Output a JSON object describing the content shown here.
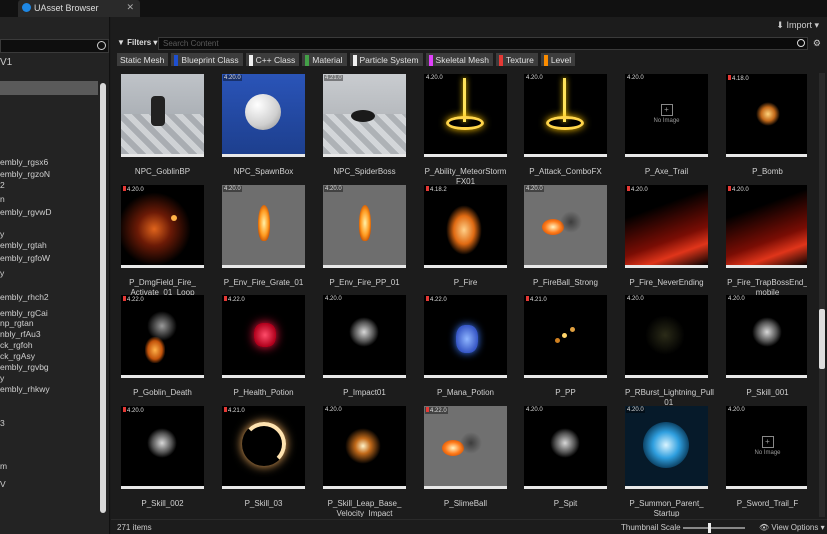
{
  "window": {
    "title": "UAsset Browser"
  },
  "sidebar": {
    "header": "V1",
    "items": [
      "embly_rgsx6",
      "embly_rgzoN",
      "2",
      "n",
      "embly_rgvwD",
      "y",
      "embly_rgtah",
      "embly_rgfoW",
      "y",
      "embly_rhch2",
      "embly_rgCai",
      "np_rgtan",
      "nbly_rfAu3",
      "ck_rgfoh",
      "ck_rgAsy",
      "embly_rgvbg",
      "y",
      "embly_rhkwy",
      "3",
      "m",
      "V"
    ]
  },
  "toolbar": {
    "import_label": "Import"
  },
  "filters": {
    "button_label": "Filters",
    "search_placeholder": "Search Content",
    "chips": [
      {
        "label": "Static Mesh",
        "color": "#1e88e5",
        "active": false
      },
      {
        "label": "Blueprint Class",
        "color": "#1e4fd0"
      },
      {
        "label": "C++ Class",
        "color": "#f0f0f0"
      },
      {
        "label": "Material",
        "color": "#43a047"
      },
      {
        "label": "Particle System",
        "color": "#f0f0f0"
      },
      {
        "label": "Skeletal Mesh",
        "color": "#e040fb"
      },
      {
        "label": "Texture",
        "color": "#e53935"
      },
      {
        "label": "Level",
        "color": "#fb8c00"
      }
    ]
  },
  "assets": [
    {
      "name": "NPC_GoblinBP",
      "ver": "",
      "kind": "goblin"
    },
    {
      "name": "NPC_SpawnBox",
      "ver": "4.20.0",
      "kind": "sphere"
    },
    {
      "name": "NPC_SpiderBoss",
      "ver": "4.21.0",
      "kind": "spider"
    },
    {
      "name": "P_Ability_MeteorStorm\nFX01",
      "ver": "4.20.0",
      "kind": "lightning"
    },
    {
      "name": "P_Attack_ComboFX",
      "ver": "4.20.0",
      "kind": "lightning"
    },
    {
      "name": "P_Axe_Trail",
      "ver": "4.20.0",
      "kind": "noimage",
      "noimage": "No Image"
    },
    {
      "name": "P_Bomb",
      "ver": "4.18.0",
      "kind": "spark",
      "red": true
    },
    {
      "name": "P_DmgField_Fire_\nActivate_01_Loop",
      "ver": "4.20.0",
      "kind": "embers",
      "red": true
    },
    {
      "name": "P_Env_Fire_Grate_01",
      "ver": "4.20.0",
      "kind": "flame"
    },
    {
      "name": "P_Env_Fire_PP_01",
      "ver": "4.20.0",
      "kind": "flame"
    },
    {
      "name": "P_Fire",
      "ver": "4.18.2",
      "kind": "fire",
      "red": true
    },
    {
      "name": "P_FireBall_Strong",
      "ver": "4.20.0",
      "kind": "fireball"
    },
    {
      "name": "P_Fire_NeverEnding",
      "ver": "4.20.0",
      "kind": "firewall",
      "red": true
    },
    {
      "name": "P_Fire_TrapBossEnd_\nmobile",
      "ver": "4.20.0",
      "kind": "firewall",
      "red": true
    },
    {
      "name": "P_Goblin_Death",
      "ver": "4.22.0",
      "kind": "smokefire",
      "red": true
    },
    {
      "name": "P_Health_Potion",
      "ver": "4.22.0",
      "kind": "potionred",
      "red": true
    },
    {
      "name": "P_Impact01",
      "ver": "4.20.0",
      "kind": "smoke"
    },
    {
      "name": "P_Mana_Potion",
      "ver": "4.22.0",
      "kind": "potionblue",
      "red": true
    },
    {
      "name": "P_PP",
      "ver": "4.21.0",
      "kind": "sparks",
      "red": true
    },
    {
      "name": "P_RBurst_Lightning_Pull\n_01",
      "ver": "4.20.0",
      "kind": "dark"
    },
    {
      "name": "P_Skill_001",
      "ver": "4.20.0",
      "kind": "smoke"
    },
    {
      "name": "P_Skill_002",
      "ver": "4.20.0",
      "kind": "smoke",
      "red": true
    },
    {
      "name": "P_Skill_03",
      "ver": "4.21.0",
      "kind": "ring",
      "red": true
    },
    {
      "name": "P_Skill_Leap_Base_\nVelocity_Impact",
      "ver": "4.20.0",
      "kind": "burst"
    },
    {
      "name": "P_SlimeBall",
      "ver": "4.22.0",
      "kind": "fireball",
      "red": true
    },
    {
      "name": "P_Spit",
      "ver": "4.20.0",
      "kind": "smoke"
    },
    {
      "name": "P_Summon_Parent_\nStartup",
      "ver": "4.20.0",
      "kind": "blueorb"
    },
    {
      "name": "P_Sword_Trail_F",
      "ver": "4.20.0",
      "kind": "noimage",
      "noimage": "No Image"
    }
  ],
  "status": {
    "items_count": "271 items",
    "thumbnail_scale_label": "Thumbnail Scale",
    "view_options_label": "View Options"
  },
  "colors": {
    "accent": "#e53935",
    "selection": "#5a5a5a"
  }
}
